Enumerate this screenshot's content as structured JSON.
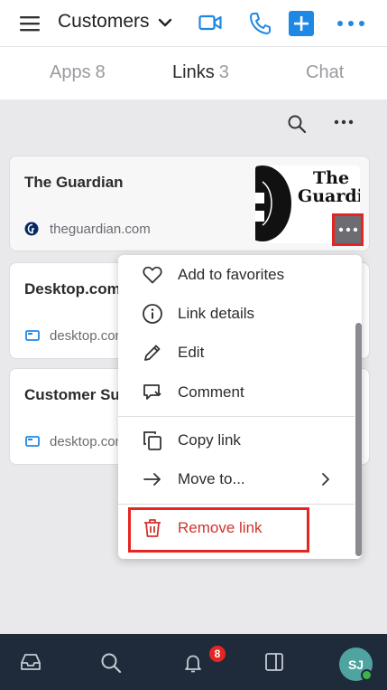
{
  "header": {
    "title": "Customers",
    "icons": [
      "hamburger-menu-icon",
      "chevron-down-icon",
      "video-call-icon",
      "phone-icon",
      "plus-icon",
      "more-icon"
    ],
    "accent_color": "#1e88e5"
  },
  "tabs": [
    {
      "label": "Apps",
      "count": "8"
    },
    {
      "label": "Links",
      "count": "3"
    },
    {
      "label": "Chat",
      "count": ""
    }
  ],
  "cards": [
    {
      "title": "The Guardian",
      "host": "theguardian.com",
      "thumbnail_text": "The Guardian"
    },
    {
      "title": "Desktop.com",
      "host": "desktop.com"
    },
    {
      "title": "Customer Su",
      "host": "desktop.com"
    }
  ],
  "context_menu": {
    "items": [
      {
        "label": "Add to favorites",
        "icon": "heart-icon"
      },
      {
        "label": "Link details",
        "icon": "info-icon"
      },
      {
        "label": "Edit",
        "icon": "pencil-icon"
      },
      {
        "label": "Comment",
        "icon": "comment-icon"
      },
      {
        "label": "Copy link",
        "icon": "copy-icon"
      },
      {
        "label": "Move to...",
        "icon": "arrow-right-icon"
      },
      {
        "label": "Remove link",
        "icon": "trash-icon"
      }
    ],
    "danger_color": "#d0342c"
  },
  "bottom_nav": {
    "notifications_badge": "8",
    "avatar_initials": "SJ"
  }
}
